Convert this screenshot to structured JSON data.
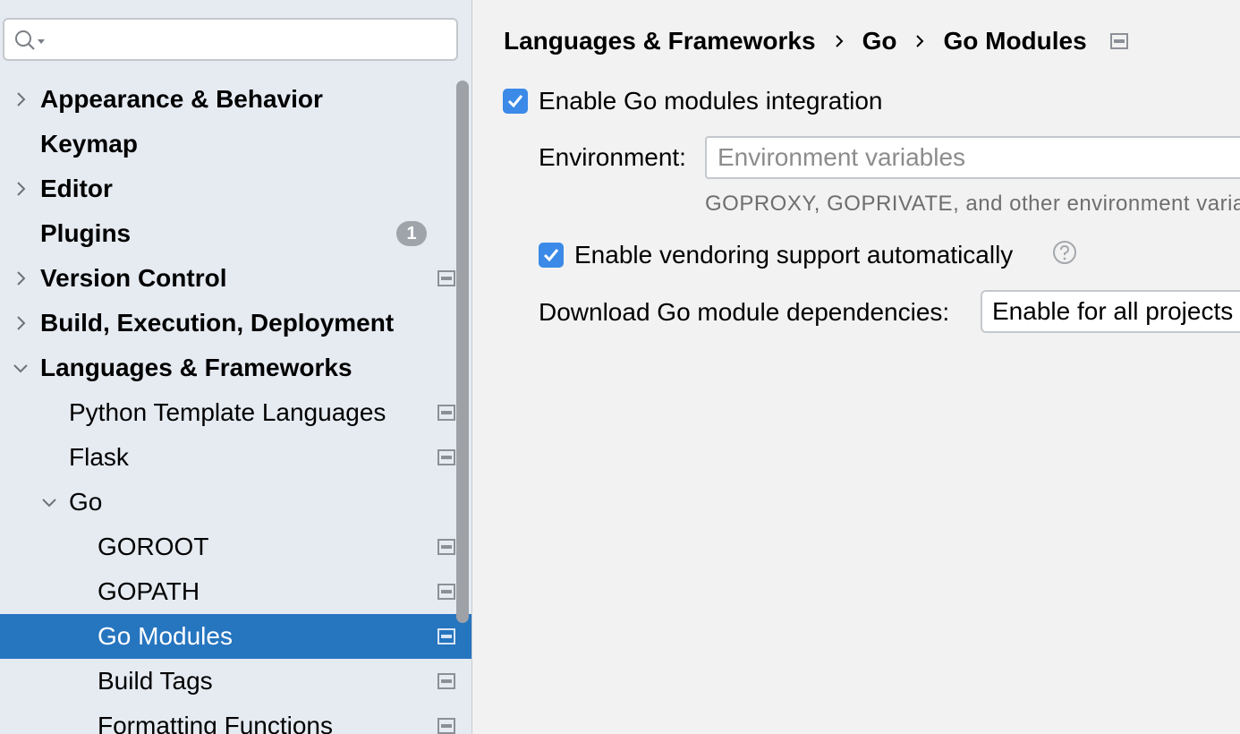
{
  "search": {
    "placeholder": ""
  },
  "sidebar": {
    "items": [
      {
        "label": "Appearance & Behavior"
      },
      {
        "label": "Keymap"
      },
      {
        "label": "Editor"
      },
      {
        "label": "Plugins",
        "badge": "1"
      },
      {
        "label": "Version Control"
      },
      {
        "label": "Build, Execution, Deployment"
      },
      {
        "label": "Languages & Frameworks"
      },
      {
        "label": "Python Template Languages"
      },
      {
        "label": "Flask"
      },
      {
        "label": "Go"
      },
      {
        "label": "GOROOT"
      },
      {
        "label": "GOPATH"
      },
      {
        "label": "Go Modules"
      },
      {
        "label": "Build Tags"
      },
      {
        "label": "Formatting Functions"
      }
    ]
  },
  "breadcrumb": {
    "items": [
      "Languages & Frameworks",
      "Go",
      "Go Modules"
    ]
  },
  "settings": {
    "enable_modules_label": "Enable Go modules integration",
    "environment_label": "Environment:",
    "environment_placeholder": "Environment variables",
    "environment_hint": "GOPROXY, GOPRIVATE, and other environment variables",
    "vendoring_label": "Enable vendoring support automatically",
    "download_label": "Download Go module dependencies:",
    "download_value": "Enable for all projects"
  },
  "colors": {
    "selection": "#2675bf",
    "checkbox": "#3b8ae8",
    "sidebar_bg": "#e6ebf2"
  }
}
